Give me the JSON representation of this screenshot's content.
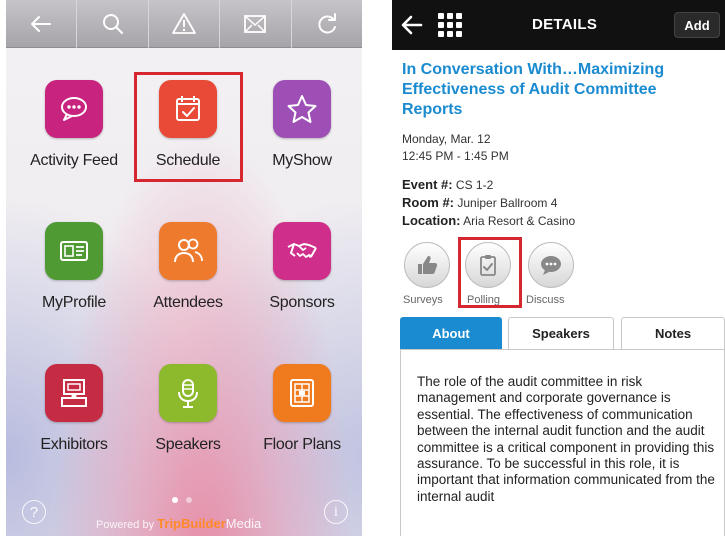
{
  "left_app": {
    "toolbar": [
      "back-arrow-icon",
      "search-icon",
      "alert-icon",
      "mail-icon",
      "refresh-icon"
    ],
    "tiles": [
      {
        "label": "Activity Feed",
        "icon": "chat-bubble-icon",
        "color": "#c8237f"
      },
      {
        "label": "Schedule",
        "icon": "calendar-check-icon",
        "color": "#e84a37"
      },
      {
        "label": "MyShow",
        "icon": "star-icon",
        "color": "#9d4fb6"
      },
      {
        "label": "MyProfile",
        "icon": "id-card-icon",
        "color": "#4f9a32"
      },
      {
        "label": "Attendees",
        "icon": "people-icon",
        "color": "#ee7a2e"
      },
      {
        "label": "Sponsors",
        "icon": "handshake-icon",
        "color": "#cf2f8a"
      },
      {
        "label": "Exhibitors",
        "icon": "booth-icon",
        "color": "#c52c44"
      },
      {
        "label": "Speakers",
        "icon": "microphone-icon",
        "color": "#8cba2c"
      },
      {
        "label": "Floor Plans",
        "icon": "floor-plan-icon",
        "color": "#f07a1e"
      }
    ],
    "footer": {
      "help": "?",
      "info": "i",
      "powered_prefix": "Powered by ",
      "brand": "TripBuilder",
      "brand_suffix": "Media",
      "page_index": 0,
      "page_count": 2
    }
  },
  "right_app": {
    "header": {
      "title": "DETAILS",
      "add": "Add"
    },
    "session_title": "In Conversation With…Maximizing Effectiveness of Audit Committee Reports",
    "date": "Monday, Mar. 12",
    "time": "12:45 PM - 1:45 PM",
    "event_label": "Event #:",
    "event_value": "CS 1-2",
    "room_label": "Room #:",
    "room_value": "Juniper Ballroom 4",
    "location_label": "Location:",
    "location_value": "Aria Resort & Casino",
    "actions": [
      "Surveys",
      "Polling",
      "Discuss"
    ],
    "tabs": [
      "About",
      "Speakers",
      "Notes"
    ],
    "about_text": "The role of the audit committee in risk management and corporate governance is essential. The effectiveness of communication between the internal audit function and the audit committee is a critical component in providing this assurance. To be successful in this role, it is important that information communicated from the internal audit",
    "accent": "#1a8bd0"
  },
  "highlight_color": "#d6262f"
}
